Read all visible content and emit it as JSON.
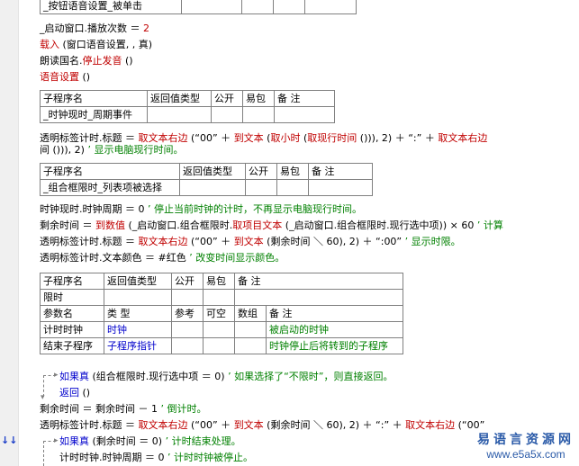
{
  "gutter": {
    "bookmark_glyph": "↓↓"
  },
  "top_table": {
    "row_label": "_按钮语音设置_被单击"
  },
  "lines_a": [
    {
      "k": "l1",
      "parts": [
        "_启动窗口.播放次数 ＝ ",
        "2"
      ]
    },
    {
      "k": "l2",
      "parts": [
        "载入",
        " (窗口语音设置, , 真)"
      ]
    },
    {
      "k": "l3",
      "parts": [
        "朗读国名.",
        "停止发音",
        " ()"
      ]
    },
    {
      "k": "l4",
      "parts": [
        "语音设置",
        " ()"
      ]
    }
  ],
  "table_clock": {
    "headers": [
      "子程序名",
      "返回值类型",
      "公开",
      "易包",
      "备 注"
    ],
    "row": [
      "_时钟现时_周期事件",
      "",
      "",
      "",
      ""
    ]
  },
  "line_clock_1": "透明标签计时.标题 ＝ ",
  "line_clock_1b": "取文本右边",
  "line_clock_1c": " (“00” ＋ ",
  "line_clock_1d": "到文本",
  "line_clock_1e": " (",
  "line_clock_1f": "取小时",
  "line_clock_1g": " (",
  "line_clock_1h": "取现行时间",
  "line_clock_1i": " ())), 2) ＋ “:” ＋ ",
  "line_clock_1j": "取文本右边",
  "line_clock_2a": "间 ())), 2)  ",
  "line_clock_2b": "’ 显示电脑现行时间。",
  "table_combo": {
    "headers": [
      "子程序名",
      "返回值类型",
      "公开",
      "易包",
      "备 注"
    ],
    "row": [
      "_组合框限时_列表项被选择",
      "",
      "",
      "",
      ""
    ]
  },
  "line_c1a": "时钟现时.时钟周期 ＝ 0  ",
  "line_c1b": "’ 停止当前时钟的计时，不再显示电脑现行时间。",
  "line_c2a": "剩余时间 ＝ ",
  "line_c2b": "到数值",
  "line_c2c": " (_启动窗口.组合框限时.",
  "line_c2d": "取项目文本",
  "line_c2e": " (_启动窗口.组合框限时.现行选中项)) × 60  ",
  "line_c2f": "’ 计算",
  "line_c3a": "透明标签计时.标题 ＝ ",
  "line_c3b": "取文本右边",
  "line_c3c": " (“00” ＋ ",
  "line_c3d": "到文本",
  "line_c3e": " (剩余时间 ＼ 60), 2) ＋ “:00”  ",
  "line_c3f": "’ 显示时限。",
  "line_c4a": "透明标签计时.文本颜色 ＝ #红色  ",
  "line_c4b": "’ 改变时间显示颜色。",
  "table_limit": {
    "headers": [
      "子程序名",
      "返回值类型",
      "公开",
      "易包",
      "备 注"
    ],
    "name": "限时",
    "param_headers": [
      "参数名",
      "类 型",
      "参考",
      "可空",
      "数组",
      "备 注"
    ],
    "params": [
      [
        "计时时钟",
        "时钟",
        "",
        "",
        "",
        "被启动的时钟"
      ],
      [
        "结束子程序",
        "子程序指针",
        "",
        "",
        "",
        "时钟停止后将转到的子程序"
      ]
    ]
  },
  "line_d1a": "如果真",
  "line_d1b": " (组合框限时.现行选中项 ＝ 0)  ",
  "line_d1c": "’ 如果选择了“不限时”，则直接返回。",
  "line_d2a": "返回",
  "line_d2b": " ()",
  "line_d3a": "剩余时间 ＝ 剩余时间 － 1  ",
  "line_d3b": "’ 倒计时。",
  "line_d4a": "透明标签计时.标题 ＝ ",
  "line_d4b": "取文本右边",
  "line_d4c": " (“00” ＋ ",
  "line_d4d": "到文本",
  "line_d4e": " (剩余时间 ＼ 60), 2) ＋ “:” ＋ ",
  "line_d4f": "取文本右边",
  "line_d4g": " (“00”",
  "line_d5a": "如果真",
  "line_d5b": " (剩余时间 ＝ 0)  ",
  "line_d5c": "’ 计时结束处理。",
  "line_d6a": "计时时钟.时钟周期 ＝ 0  ",
  "line_d6b": "’ 计时时钟被停止。",
  "watermark": {
    "line1": "易语言资源网",
    "line2": "www.e5a5x.com"
  },
  "colors": {
    "keyword": "#0000cc",
    "comment": "#008000",
    "command": "#c00000",
    "link": "#0000cc"
  }
}
